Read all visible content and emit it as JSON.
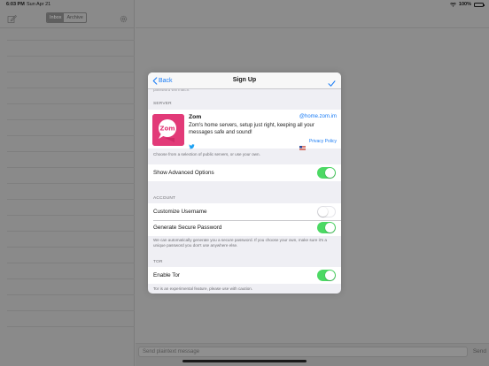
{
  "status_bar": {
    "time": "6:03 PM",
    "date": "Sun Apr 21",
    "battery": "100%",
    "battery_level": 1.0
  },
  "background": {
    "segmented": [
      "Inbox",
      "Archive"
    ],
    "message_placeholder": "Send plaintext message",
    "send_label": "Send"
  },
  "modal": {
    "back_label": "Back",
    "title": "Sign Up",
    "cut_off_text": "password will match.",
    "server_section": {
      "header": "SERVER",
      "logo_text": "Zom",
      "name": "Zom",
      "host": "@home.zom.im",
      "description": "Zom's home servers, setup just right, keeping all your messages safe and sound!",
      "privacy_label": "Privacy Policy",
      "footer": "Choose from a selection of public servers, or use your own."
    },
    "advanced": {
      "label": "Show Advanced Options",
      "enabled": true
    },
    "account_section": {
      "header": "ACCOUNT",
      "customize_label": "Customize Username",
      "customize_enabled": false,
      "password_label": "Generate Secure Password",
      "password_enabled": true,
      "footer": "We can automatically generate you a secure password. If you choose your own, make sure it's a unique password you don't use anywhere else."
    },
    "tor_section": {
      "header": "TOR",
      "label": "Enable Tor",
      "enabled": true,
      "footer": "Tor is an experimental feature, please use with caution."
    }
  },
  "colors": {
    "accent": "#1a7cf5",
    "toggle_on": "#4cd964",
    "zom_brand": "#e23a78",
    "dim_overlay": "#8c8c8c"
  }
}
